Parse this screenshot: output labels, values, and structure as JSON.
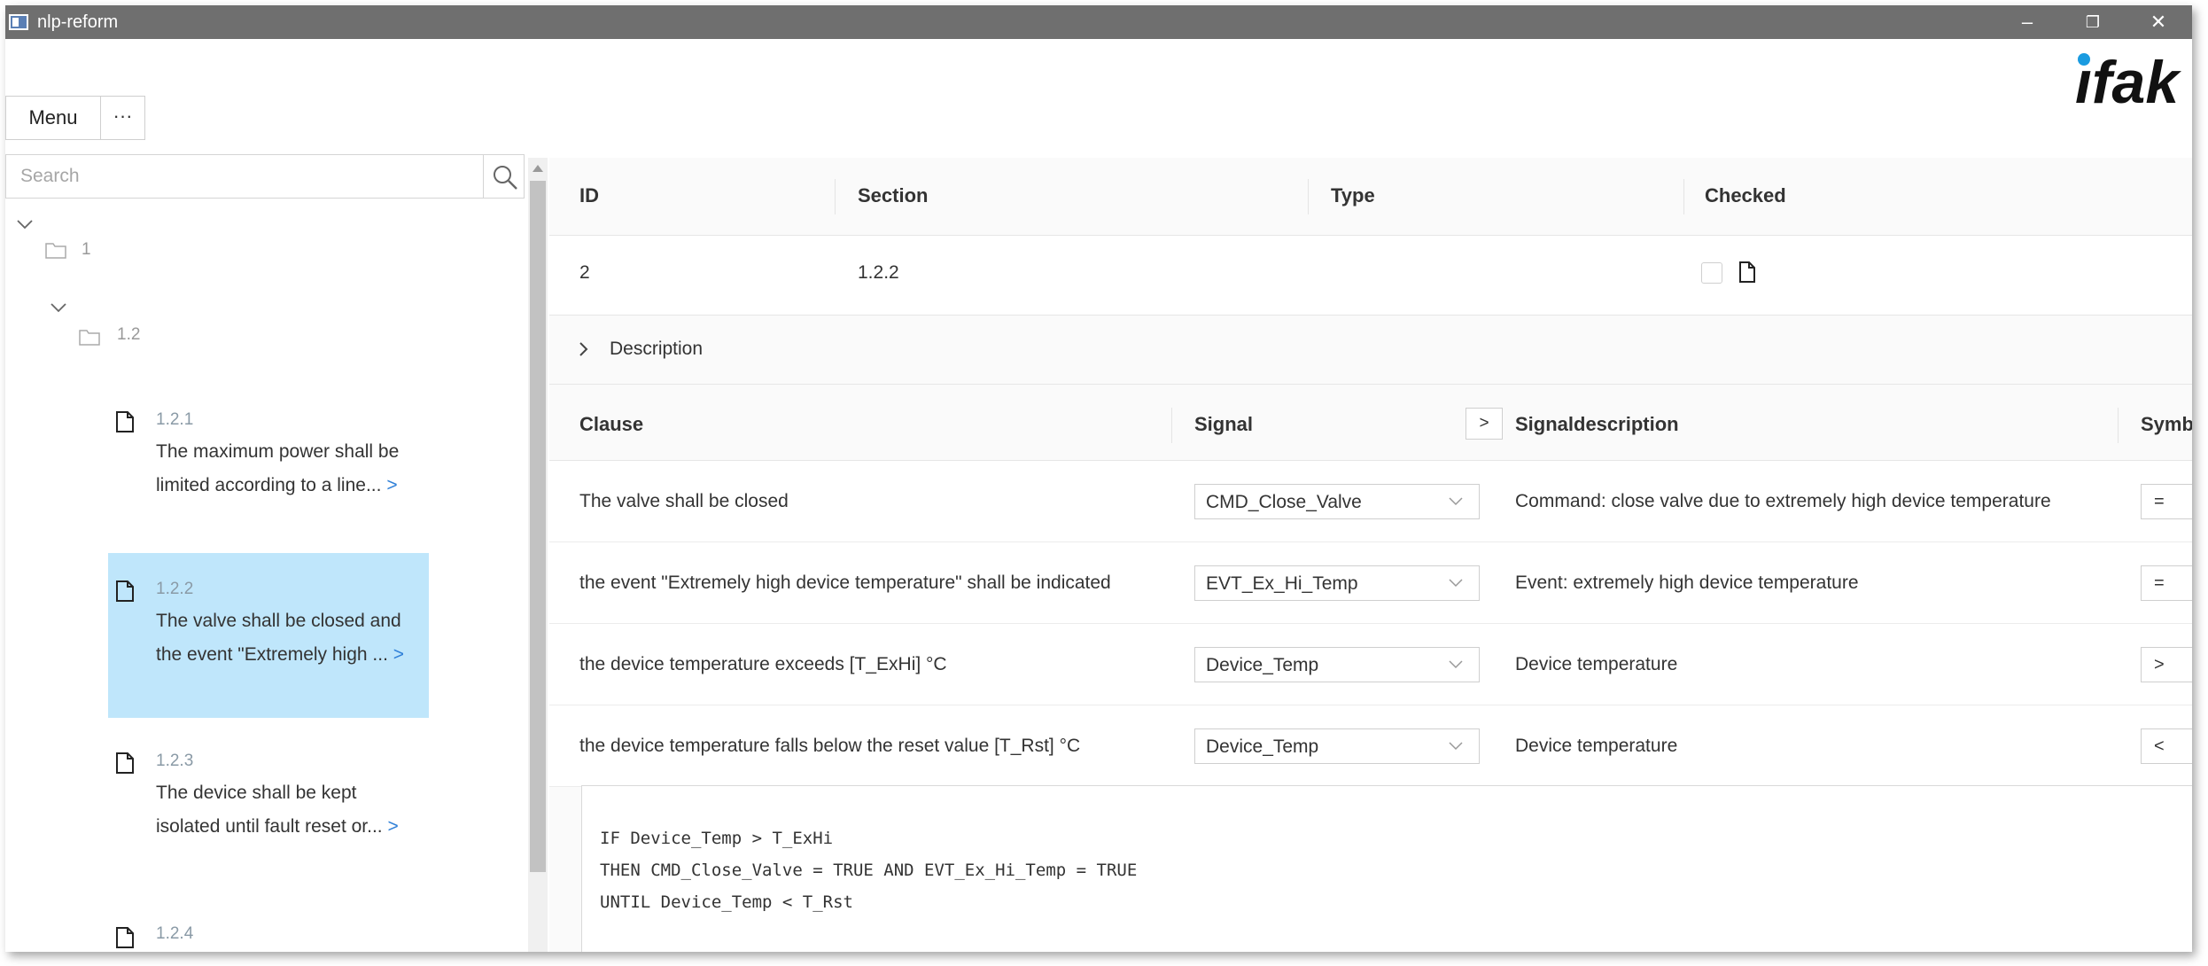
{
  "window": {
    "title": "nlp-reform"
  },
  "window_controls": {
    "minimize": "–",
    "maximize": "❐",
    "close": "✕"
  },
  "logo": {
    "text": "ifak"
  },
  "toolbar": {
    "menu_label": "Menu",
    "more_label": "···"
  },
  "search": {
    "placeholder": "Search",
    "value": ""
  },
  "tree": {
    "nodes": [
      {
        "label": "1"
      },
      {
        "label": "1.2"
      }
    ],
    "items": [
      {
        "id": "1.2.1",
        "line1": "The maximum power shall be",
        "line2": "limited according to a line...",
        "more": ">"
      },
      {
        "id": "1.2.2",
        "line1": "The valve shall be closed and",
        "line2": "the event \"Extremely high ...",
        "more": ">"
      },
      {
        "id": "1.2.3",
        "line1": "The device shall be kept",
        "line2": "isolated until fault reset or...",
        "more": ">"
      },
      {
        "id": "1.2.4",
        "line1": "",
        "line2": "",
        "more": ""
      }
    ]
  },
  "grid": {
    "headers": {
      "id": "ID",
      "section": "Section",
      "type": "Type",
      "checked": "Checked"
    },
    "row": {
      "id": "2",
      "section": "1.2.2",
      "type": ""
    }
  },
  "description": {
    "chevron": ">",
    "label": "Description"
  },
  "clauses": {
    "headers": {
      "clause": "Clause",
      "signal": "Signal",
      "expand": ">",
      "signal_description": "Signaldescription",
      "symbol": "Symbol"
    },
    "rows": [
      {
        "clause": "The valve shall be closed",
        "signal": "CMD_Close_Valve",
        "description": "Command: close valve due to extremely high device temperature",
        "symbol": "="
      },
      {
        "clause": "the event \"Extremely high device temperature\" shall be indicated",
        "signal": "EVT_Ex_Hi_Temp",
        "description": "Event: extremely high device temperature",
        "symbol": "="
      },
      {
        "clause": "the device temperature exceeds [T_ExHi] °C",
        "signal": "Device_Temp",
        "description": "Device temperature",
        "symbol": ">"
      },
      {
        "clause": "the device temperature falls below the reset value [T_Rst] °C",
        "signal": "Device_Temp",
        "description": "Device temperature",
        "symbol": "<"
      }
    ]
  },
  "code": {
    "lines": [
      "IF Device_Temp > T_ExHi",
      "THEN CMD_Close_Valve = TRUE AND EVT_Ex_Hi_Temp = TRUE",
      "UNTIL Device_Temp < T_Rst"
    ]
  },
  "colors": {
    "titlebar": "#6f6f6f",
    "selected_item": "#bfe6fb",
    "link": "#2f80d8",
    "logo_dot": "#1a9be0"
  }
}
